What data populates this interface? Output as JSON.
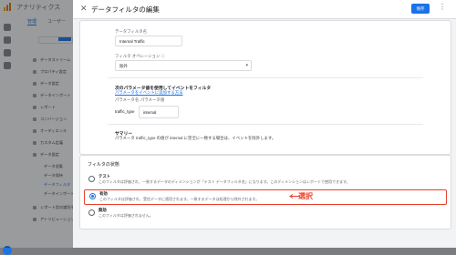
{
  "app": {
    "title": "アナリティクス"
  },
  "background": {
    "tabs": [
      "管理",
      "ユーザー"
    ],
    "items": [
      "データストリーム",
      "プロパティ設定",
      "データ設定",
      "データインポート",
      "レポート",
      "コンバージョン",
      "オーディエンス",
      "カスタム定義",
      "データ設定",
      "データ収集",
      "データ保持",
      "データフィルタ",
      "データインポート",
      "レポート用の識別子",
      "アトリビューション"
    ]
  },
  "dialog": {
    "title": "データフィルタの編集",
    "save_label": "保存",
    "name_label": "データフィルタ名",
    "name_value": "Internal Traffic",
    "operation_label": "フィルタ オペレーション",
    "operation_value": "除外",
    "param_heading": "次のパラメータ値を使用してイベントをフィルタ",
    "param_link": "パラメータをイベントに追加する方法",
    "param_name_label": "パラメータ名",
    "param_value_label": "パラメータ値",
    "param_name_value": "traffic_type",
    "param_value_value": "internal",
    "summary_heading": "サマリー",
    "summary_text": "パラメータ traffic_type の値が internal に完全に一致する場合は、イベントを除外します。",
    "state_heading": "フィルタの状態",
    "options": [
      {
        "title": "テスト",
        "desc": "このフィルタは評価され、一致するデータのディメンションが「テスト データフィルタ名」になります。このディメンションはレポートで使用できます。",
        "selected": false
      },
      {
        "title": "有効",
        "desc": "このフィルタは評価され、受信データに適用されます。一致するデータは処理から除外されます。",
        "selected": true
      },
      {
        "title": "無効",
        "desc": "このフィルタは評価されません。",
        "selected": false
      }
    ]
  },
  "annotation": {
    "label": "選択",
    "color": "#e8412c"
  },
  "icons": {
    "close": "close-icon",
    "more": "more-vert-icon",
    "help": "help-icon",
    "dropdown": "chevron-down-icon",
    "settings": "gear-icon"
  }
}
